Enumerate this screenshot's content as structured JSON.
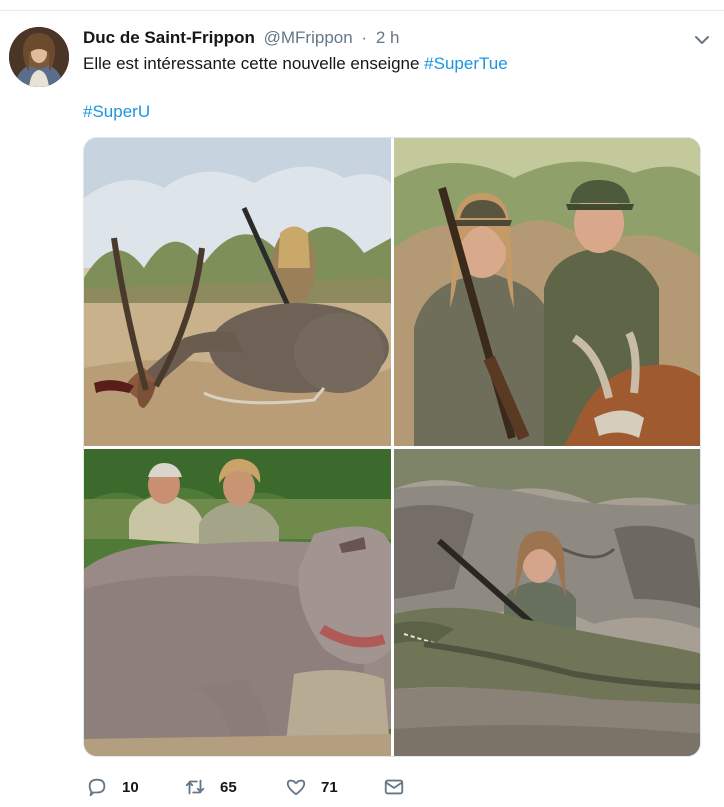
{
  "tweet": {
    "author_name": "Duc de Saint-Frippon",
    "author_handle": "@MFrippon",
    "separator": "·",
    "time": "2 h",
    "text_line1": "Elle est intéressante cette nouvelle enseigne ",
    "hashtag1": "#SuperTue",
    "hashtag2": "#SuperU"
  },
  "actions": {
    "reply_count": "10",
    "retweet_count": "65",
    "like_count": "71"
  },
  "icons": {
    "menu": "chevron-down-icon",
    "reply": "speech-bubble-icon",
    "retweet": "retweet-arrows-icon",
    "like": "heart-icon",
    "message": "envelope-icon"
  },
  "colors": {
    "text": "#14171a",
    "secondary": "#657786",
    "link": "#1b95e0"
  }
}
